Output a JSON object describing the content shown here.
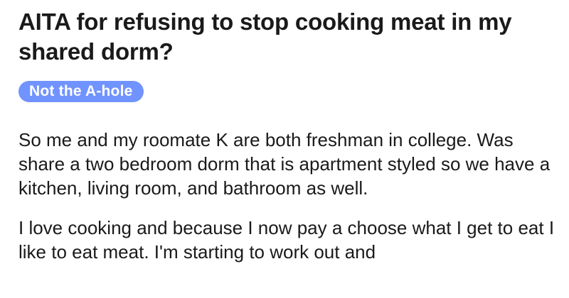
{
  "post": {
    "title": "AITA for refusing to stop cooking meat in my shared dorm?",
    "flair": {
      "label": "Not the A-hole",
      "color": "#7193ff"
    },
    "paragraphs": [
      "So me and my roomate K are both freshman in college. Was share a two bedroom dorm that is apartment styled so we have a kitchen, living room, and bathroom as well.",
      "I love cooking and because I now pay a choose what I get to eat I like to eat meat. I'm starting to work out and"
    ]
  }
}
